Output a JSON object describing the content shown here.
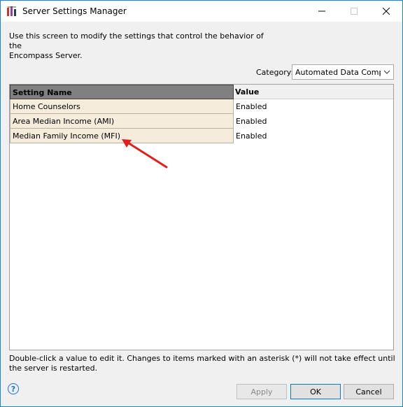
{
  "window": {
    "title": "Server Settings Manager"
  },
  "intro_text": "Use this screen to modify the settings that control the behavior of the\nEncompass Server.",
  "category": {
    "label": "Category:",
    "selected": "Automated Data Completion"
  },
  "grid": {
    "columns": [
      "Setting Name",
      "Value"
    ],
    "rows": [
      {
        "name": "Home Counselors",
        "value": "Enabled"
      },
      {
        "name": "Area Median Income (AMI)",
        "value": "Enabled"
      },
      {
        "name": "Median Family Income (MFI)",
        "value": "Enabled"
      }
    ]
  },
  "hint_text": "Double-click a value to edit it. Changes to items marked with an asterisk (*) will not take effect until the server is restarted.",
  "help_glyph": "?",
  "buttons": {
    "apply": "Apply",
    "ok": "OK",
    "cancel": "Cancel"
  },
  "colors": {
    "header_selected": "#808080",
    "name_cell": "#f5ecdc",
    "annotation_arrow": "#e02020",
    "window_border": "#1883d7"
  }
}
